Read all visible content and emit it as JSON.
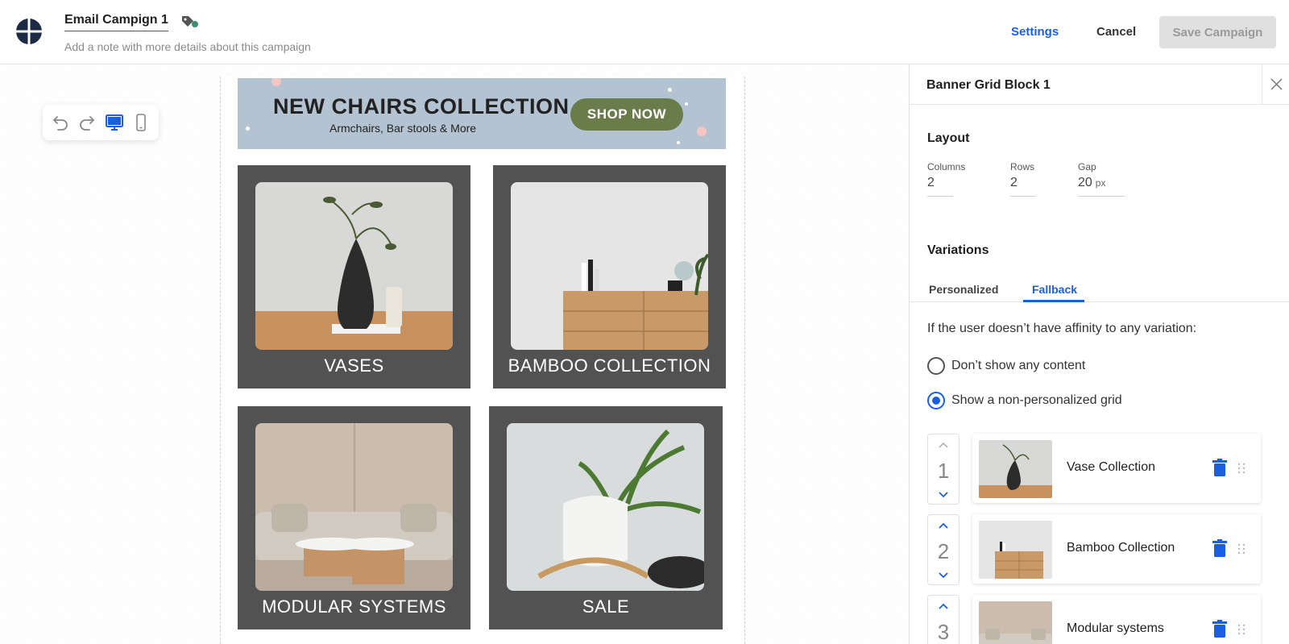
{
  "header": {
    "campaign_name": "Email Campign 1",
    "note_placeholder": "Add a note with more details about this campaign",
    "settings_label": "Settings",
    "cancel_label": "Cancel",
    "save_label": "Save Campaign"
  },
  "toolbar": {
    "icons": [
      "undo-icon",
      "redo-icon",
      "desktop-icon",
      "mobile-icon"
    ],
    "active": "desktop-icon"
  },
  "email": {
    "hero": {
      "title": "NEW CHAIRS COLLECTION",
      "subtitle": "Armchairs, Bar stools & More",
      "button": "SHOP NOW"
    },
    "tiles": [
      {
        "label": "VASES"
      },
      {
        "label": "BAMBOO COLLECTION"
      },
      {
        "label": "MODULAR SYSTEMS"
      },
      {
        "label": "SALE"
      }
    ]
  },
  "panel": {
    "title": "Banner Grid Block 1",
    "layout": {
      "heading": "Layout",
      "columns_label": "Columns",
      "columns_value": "2",
      "rows_label": "Rows",
      "rows_value": "2",
      "gap_label": "Gap",
      "gap_value": "20",
      "gap_unit": "px"
    },
    "variations": {
      "heading": "Variations",
      "tabs": [
        "Personalized",
        "Fallback"
      ],
      "active_tab": "Fallback",
      "fallback_text": "If the user doesn’t have affinity to any variation:",
      "options": [
        "Don’t show any content",
        "Show a non-personalized grid"
      ],
      "selected_option": "Show a non-personalized grid"
    },
    "items": [
      {
        "order": "1",
        "name": "Vase Collection"
      },
      {
        "order": "2",
        "name": "Bamboo Collection"
      },
      {
        "order": "3",
        "name": "Modular systems"
      }
    ]
  },
  "colors": {
    "accent": "#1a5fe0",
    "tile_bg": "#525252",
    "hero_bg": "#b3c3d2",
    "hero_button": "#6a7c4a"
  }
}
